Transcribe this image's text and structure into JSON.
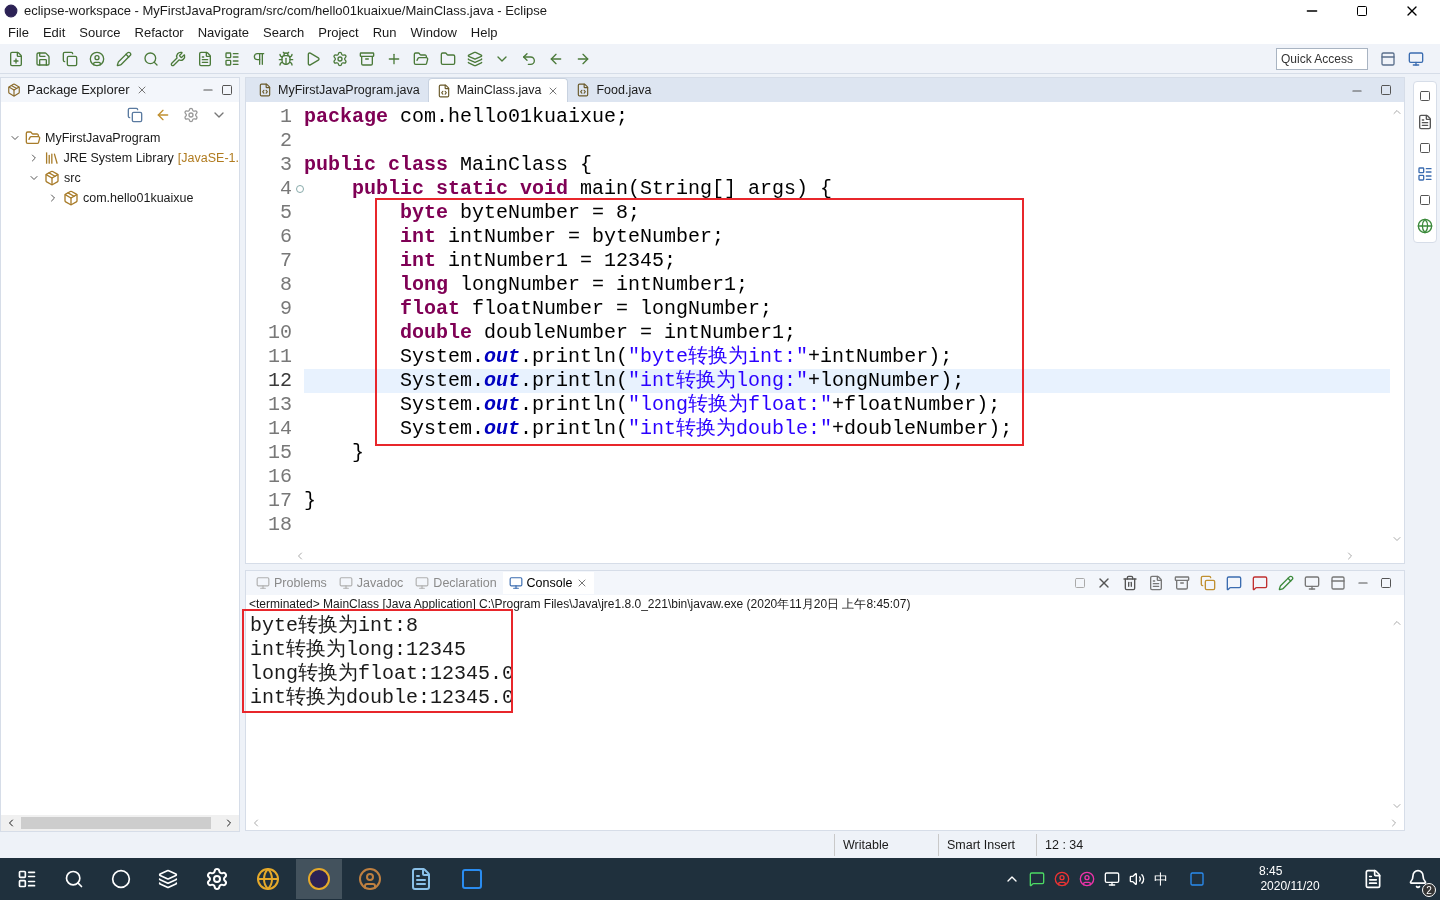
{
  "window": {
    "title": "eclipse-workspace - MyFirstJavaProgram/src/com/hello01kuaixue/MainClass.java - Eclipse"
  },
  "menu": [
    "File",
    "Edit",
    "Source",
    "Refactor",
    "Navigate",
    "Search",
    "Project",
    "Run",
    "Window",
    "Help"
  ],
  "quick_access": {
    "placeholder": "Quick Access"
  },
  "package_explorer": {
    "title": "Package Explorer",
    "tree": [
      {
        "kind": "project",
        "label": "MyFirstJavaProgram",
        "expanded": true,
        "children": [
          {
            "kind": "library",
            "label": "JRE System Library",
            "suffix": "[JavaSE-1.",
            "expanded": false
          },
          {
            "kind": "folder",
            "label": "src",
            "expanded": true,
            "children": [
              {
                "kind": "package",
                "label": "com.hello01kuaixue",
                "expanded": false
              }
            ]
          }
        ]
      }
    ]
  },
  "editor": {
    "tabs": [
      {
        "label": "MyFirstJavaProgram.java",
        "selected": false
      },
      {
        "label": "MainClass.java",
        "selected": true
      },
      {
        "label": "Food.java",
        "selected": false
      }
    ],
    "lines": [
      {
        "number": "1",
        "current": false,
        "foldable": false,
        "tokens": [
          {
            "kind": "kw",
            "text": "package"
          },
          {
            "kind": "plain",
            "text": " com.hello01kuaixue;"
          }
        ]
      },
      {
        "number": "2",
        "current": false,
        "foldable": false
      },
      {
        "number": "3",
        "current": false,
        "foldable": false,
        "tokens": [
          {
            "kind": "kw",
            "text": "public class"
          },
          {
            "kind": "plain",
            "text": " MainClass {"
          }
        ]
      },
      {
        "number": "4",
        "current": false,
        "foldable": true,
        "tokens": [
          {
            "kind": "kw",
            "text": "    public static void"
          },
          {
            "kind": "plain",
            "text": " main(String[] args) {"
          }
        ]
      },
      {
        "number": "5",
        "current": false,
        "foldable": false,
        "tokens": [
          {
            "kind": "kw",
            "text": "        byte"
          },
          {
            "kind": "plain",
            "text": " byteNumber = 8;"
          }
        ]
      },
      {
        "number": "6",
        "current": false,
        "foldable": false,
        "tokens": [
          {
            "kind": "kw",
            "text": "        int"
          },
          {
            "kind": "plain",
            "text": " intNumber = byteNumber;"
          }
        ]
      },
      {
        "number": "7",
        "current": false,
        "foldable": false,
        "tokens": [
          {
            "kind": "kw",
            "text": "        int"
          },
          {
            "kind": "plain",
            "text": " intNumber1 = 12345;"
          }
        ]
      },
      {
        "number": "8",
        "current": false,
        "foldable": false,
        "tokens": [
          {
            "kind": "kw",
            "text": "        long"
          },
          {
            "kind": "plain",
            "text": " longNumber = intNumber1;"
          }
        ]
      },
      {
        "number": "9",
        "current": false,
        "foldable": false,
        "tokens": [
          {
            "kind": "kw",
            "text": "        float"
          },
          {
            "kind": "plain",
            "text": " floatNumber = longNumber;"
          }
        ]
      },
      {
        "number": "10",
        "current": false,
        "foldable": false,
        "tokens": [
          {
            "kind": "kw",
            "text": "        double"
          },
          {
            "kind": "plain",
            "text": " doubleNumber = intNumber1;"
          }
        ]
      },
      {
        "number": "11",
        "current": false,
        "foldable": false,
        "tokens": [
          {
            "kind": "plain",
            "text": "        System."
          },
          {
            "kind": "field",
            "text": "out"
          },
          {
            "kind": "plain",
            "text": ".println("
          },
          {
            "kind": "str",
            "text": "\"byte转换为int:\""
          },
          {
            "kind": "plain",
            "text": "+intNumber);"
          }
        ]
      },
      {
        "number": "12",
        "current": true,
        "foldable": false,
        "tokens": [
          {
            "kind": "plain",
            "text": "        System."
          },
          {
            "kind": "field",
            "text": "out"
          },
          {
            "kind": "plain",
            "text": ".println("
          },
          {
            "kind": "str",
            "text": "\"int转换为long:\""
          },
          {
            "kind": "plain",
            "text": "+longNumber);"
          }
        ]
      },
      {
        "number": "13",
        "current": false,
        "foldable": false,
        "tokens": [
          {
            "kind": "plain",
            "text": "        System."
          },
          {
            "kind": "field",
            "text": "out"
          },
          {
            "kind": "plain",
            "text": ".println("
          },
          {
            "kind": "str",
            "text": "\"long转换为float:\""
          },
          {
            "kind": "plain",
            "text": "+floatNumber);"
          }
        ]
      },
      {
        "number": "14",
        "current": false,
        "foldable": false,
        "tokens": [
          {
            "kind": "plain",
            "text": "        System."
          },
          {
            "kind": "field",
            "text": "out"
          },
          {
            "kind": "plain",
            "text": ".println("
          },
          {
            "kind": "str",
            "text": "\"int转换为double:\""
          },
          {
            "kind": "plain",
            "text": "+doubleNumber);"
          }
        ]
      },
      {
        "number": "15",
        "current": false,
        "foldable": false,
        "tokens": [
          {
            "kind": "plain",
            "text": "    }"
          }
        ]
      },
      {
        "number": "16",
        "current": false,
        "foldable": false
      },
      {
        "number": "17",
        "current": false,
        "foldable": false,
        "tokens": [
          {
            "kind": "plain",
            "text": "}"
          }
        ]
      },
      {
        "number": "18",
        "current": false,
        "foldable": false
      }
    ]
  },
  "console": {
    "tabs": [
      {
        "label": "Problems",
        "selected": false
      },
      {
        "label": "Javadoc",
        "selected": false
      },
      {
        "label": "Declaration",
        "selected": false
      },
      {
        "label": "Console",
        "selected": true
      }
    ],
    "header": "<terminated> MainClass [Java Application] C:\\Program Files\\Java\\jre1.8.0_221\\bin\\javaw.exe (2020年11月20日 上午8:45:07)",
    "output": [
      "byte转换为int:8",
      "int转换为long:12345",
      "long转换为float:12345.0",
      "int转换为double:12345.0"
    ]
  },
  "status_bar": [
    "Writable",
    "Smart Insert",
    "12 : 34"
  ],
  "taskbar": {
    "ime": "中",
    "time": "8:45",
    "date": "2020/11/20",
    "notifications": "2"
  }
}
